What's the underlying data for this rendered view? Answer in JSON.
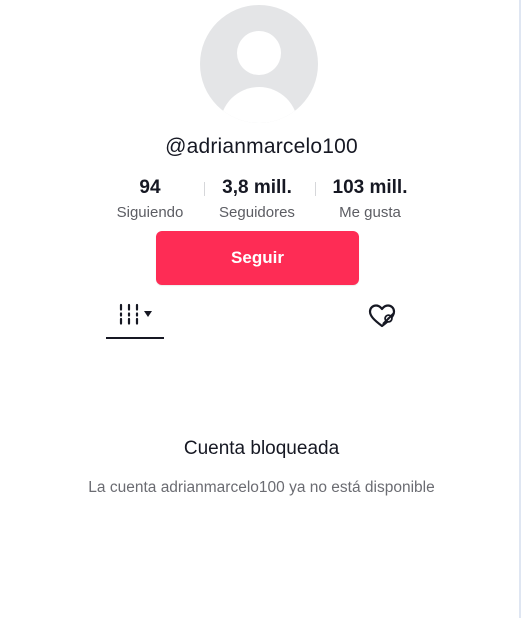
{
  "profile": {
    "username": "@adrianmarcelo100",
    "avatar_icon": "default-avatar-icon"
  },
  "stats": {
    "following": {
      "value": "94",
      "label": "Siguiendo"
    },
    "followers": {
      "value": "3,8 mill.",
      "label": "Seguidores"
    },
    "likes": {
      "value": "103 mill.",
      "label": "Me gusta"
    }
  },
  "actions": {
    "follow_label": "Seguir",
    "accent_color": "#fe2c55"
  },
  "tabs": {
    "videos_icon": "grid-icon",
    "videos_dropdown_icon": "caret-down-icon",
    "liked_icon": "hidden-liked-heart-icon"
  },
  "blocked": {
    "title": "Cuenta bloqueada",
    "description": "La cuenta adrianmarcelo100 ya no está disponible"
  }
}
